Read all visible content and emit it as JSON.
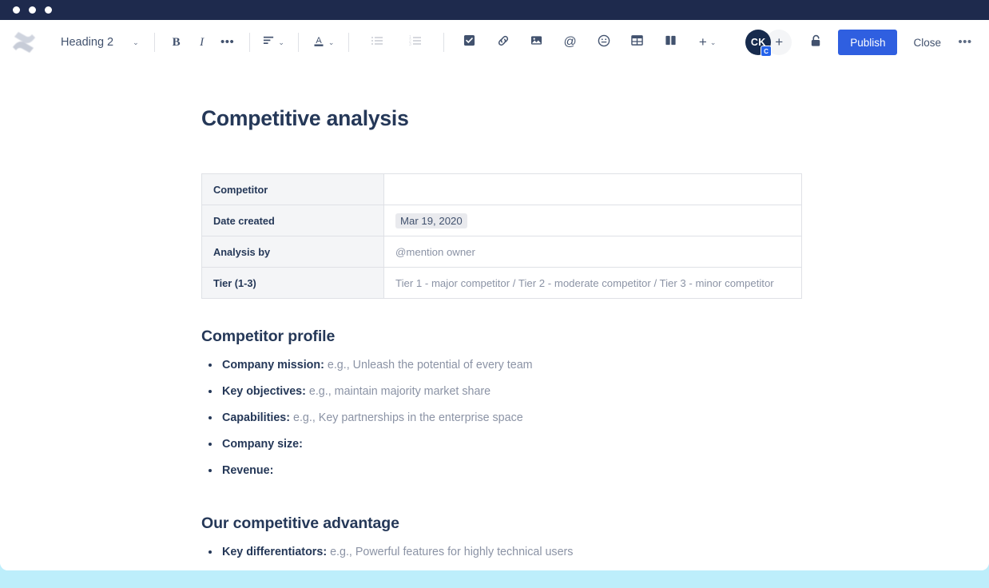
{
  "window": {
    "traffic_lights": [
      "close",
      "minimize",
      "maximize"
    ],
    "chrome_color": "#1e2a4d",
    "page_background": "#bdeefb"
  },
  "toolbar": {
    "logo_icon": "confluence-logo-icon",
    "style_select": {
      "label": "Heading 2",
      "caret": "⌄"
    },
    "bold_label": "B",
    "italic_label": "I",
    "more_formatting_label": "•••",
    "align_icon": "align-left-icon",
    "text_color_label": "A",
    "bullet_list_icon": "bullet-list-icon",
    "numbered_list_icon": "numbered-list-icon",
    "task_icon": "checkbox-task-icon",
    "link_icon": "link-icon",
    "image_icon": "image-icon",
    "mention_label": "@",
    "emoji_icon": "emoji-icon",
    "table_icon": "table-icon",
    "layout_icon": "page-layout-icon",
    "insert_label": "+",
    "caret": "⌄",
    "avatar_initials": "CK",
    "avatar_badge_label": "C",
    "add_user_label": "+",
    "lock_icon": "unlock-padlock-icon",
    "publish_label": "Publish",
    "close_label": "Close",
    "overflow_label": "•••",
    "accent_color": "#2f5fe0"
  },
  "document": {
    "title": "Competitive analysis",
    "table": {
      "rows": [
        {
          "key": "Competitor",
          "value": "",
          "value_type": "empty"
        },
        {
          "key": "Date created",
          "value": "Mar 19, 2020",
          "value_type": "chip"
        },
        {
          "key": "Analysis by",
          "value": "@mention owner",
          "value_type": "placeholder"
        },
        {
          "key": "Tier (1-3)",
          "value": "Tier 1 - major competitor / Tier 2 - moderate competitor / Tier 3 - minor competitor",
          "value_type": "placeholder"
        }
      ]
    },
    "sections": [
      {
        "heading": "Competitor profile",
        "items": [
          {
            "label": "Company mission:",
            "text": " e.g., Unleash the potential of every team"
          },
          {
            "label": "Key objectives:",
            "text": " e.g., maintain majority market share"
          },
          {
            "label": "Capabilities:",
            "text": " e.g., Key partnerships in the enterprise space"
          },
          {
            "label": "Company size:",
            "text": ""
          },
          {
            "label": "Revenue:",
            "text": ""
          }
        ]
      },
      {
        "heading": "Our competitive advantage",
        "items": [
          {
            "label": "Key differentiators:",
            "text": " e.g., Powerful features for highly technical users"
          }
        ]
      }
    ]
  }
}
